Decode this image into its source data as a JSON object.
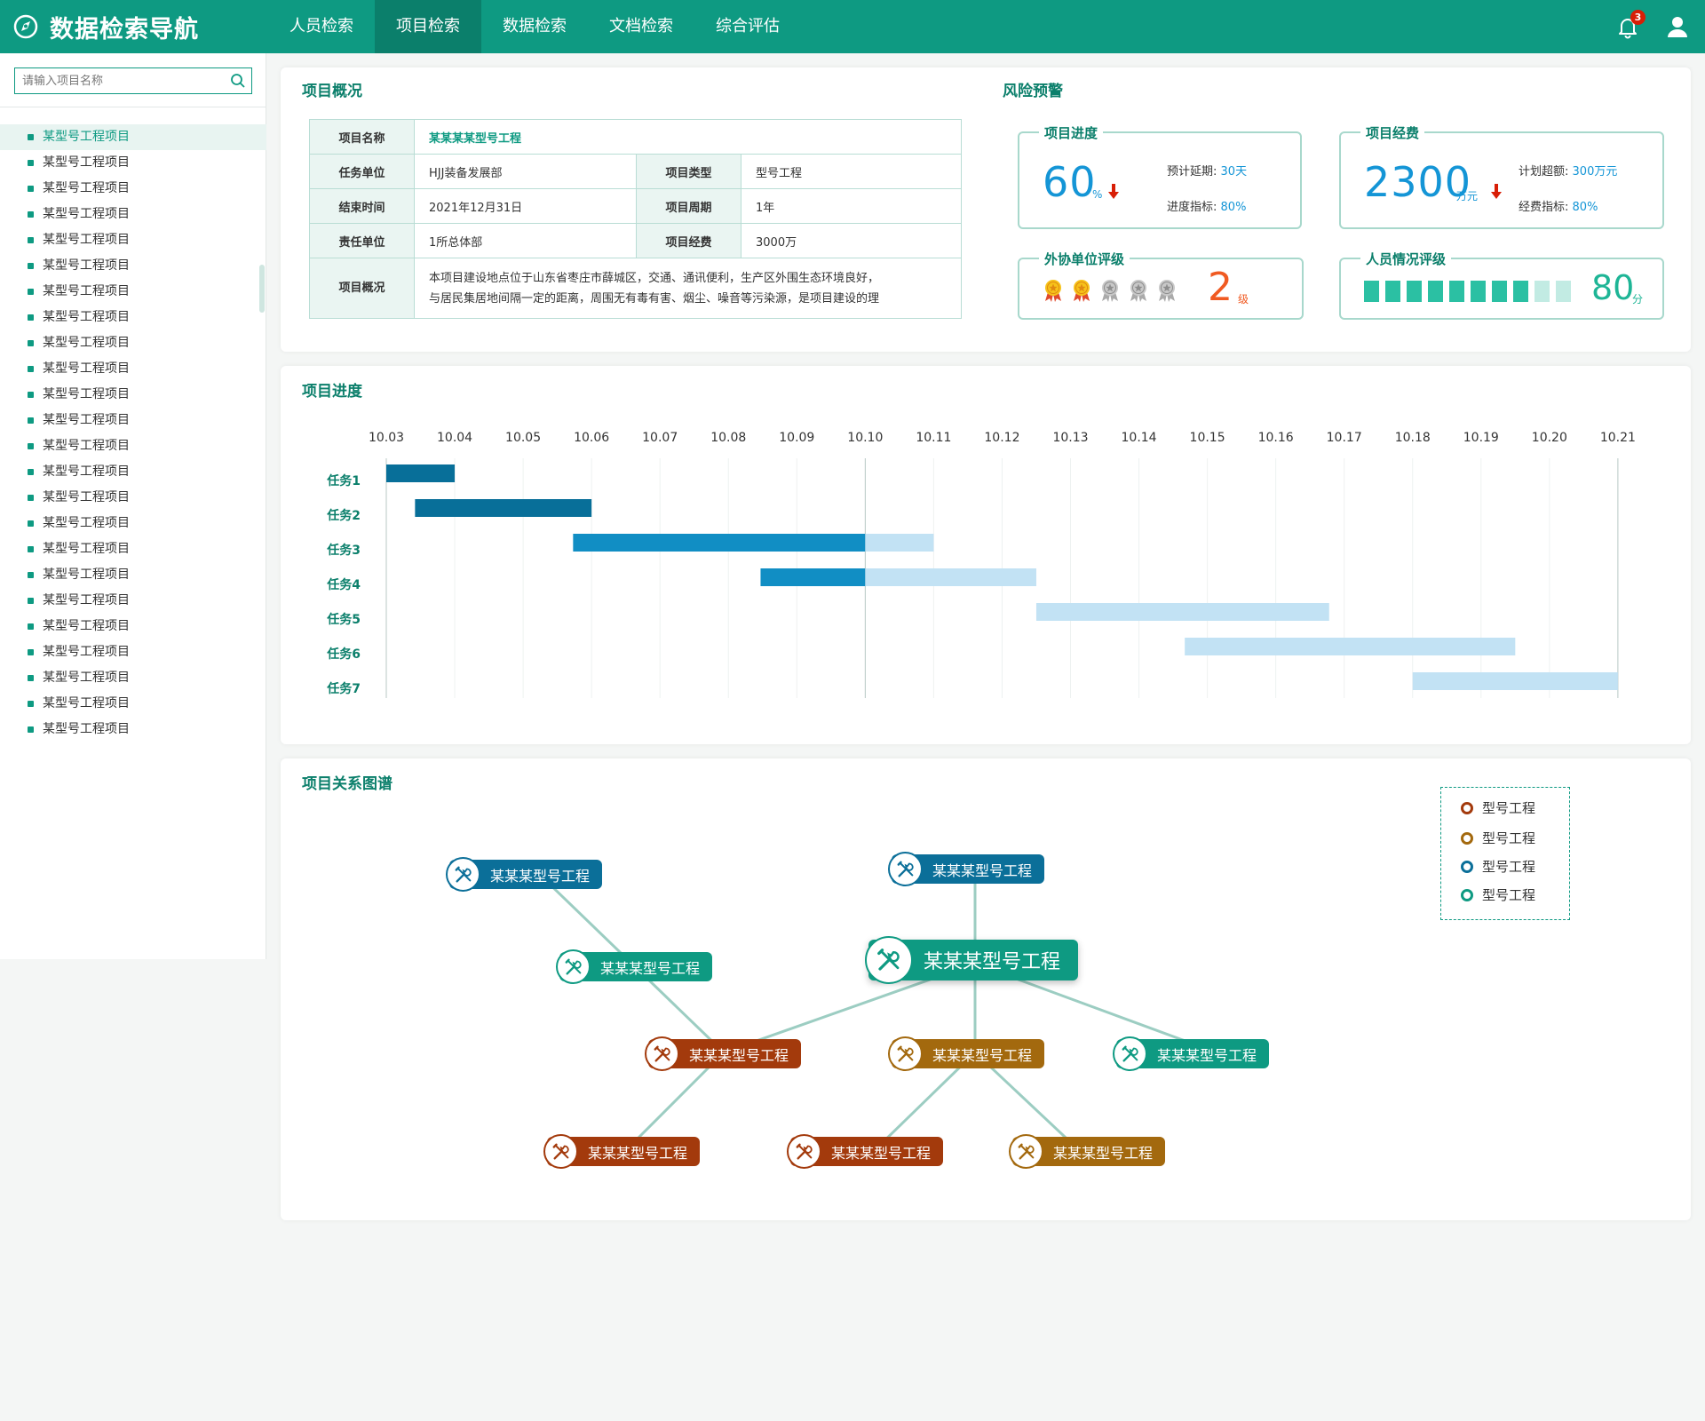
{
  "header": {
    "title": "数据检索导航",
    "nav": [
      "人员检索",
      "项目检索",
      "数据检索",
      "文档检索",
      "综合评估"
    ],
    "active_nav": 1,
    "notification_count": "3"
  },
  "sidebar": {
    "search_placeholder": "请输入项目名称",
    "items": [
      "某型号工程项目",
      "某型号工程项目",
      "某型号工程项目",
      "某型号工程项目",
      "某型号工程项目",
      "某型号工程项目",
      "某型号工程项目",
      "某型号工程项目",
      "某型号工程项目",
      "某型号工程项目",
      "某型号工程项目",
      "某型号工程项目",
      "某型号工程项目",
      "某型号工程项目",
      "某型号工程项目",
      "某型号工程项目",
      "某型号工程项目",
      "某型号工程项目",
      "某型号工程项目",
      "某型号工程项目",
      "某型号工程项目",
      "某型号工程项目",
      "某型号工程项目",
      "某型号工程项目"
    ],
    "selected_index": 0
  },
  "overview": {
    "title": "项目概况",
    "name_label": "项目名称",
    "name_value": "某某某某型号工程",
    "unit_label": "任务单位",
    "unit_value": "HJJ装备发展部",
    "type_label": "项目类型",
    "type_value": "型号工程",
    "end_label": "结束时间",
    "end_value": "2021年12月31日",
    "cycle_label": "项目周期",
    "cycle_value": "1年",
    "resp_label": "责任单位",
    "resp_value": "1所总体部",
    "fund_label": "项目经费",
    "fund_value": "3000万",
    "summary_label": "项目概况",
    "summary_line1": "本项目建设地点位于山东省枣庄市薛城区，交通、通讯便利，生产区外围生态环境良好，",
    "summary_line2": "与居民集居地间隔一定的距离，周围无有毒有害、烟尘、噪音等污染源，是项目建设的理"
  },
  "risk": {
    "title": "风险预警",
    "progress": {
      "title": "项目进度",
      "value": "60",
      "unit": "%",
      "delay_label": "预计延期:",
      "delay_value": "30天",
      "index_label": "进度指标:",
      "index_value": "80%"
    },
    "fund": {
      "title": "项目经费",
      "value": "2300",
      "unit": "万元",
      "over_label": "计划超额:",
      "over_value": "300万元",
      "index_label": "经费指标:",
      "index_value": "80%"
    },
    "partner": {
      "title": "外协单位评级",
      "gold_medals": 2,
      "total_medals": 5,
      "level": "2",
      "level_unit": "级"
    },
    "staff": {
      "title": "人员情况评级",
      "score": "80",
      "score_unit": "分",
      "filled_segments": 8,
      "total_segments": 10
    }
  },
  "gantt": {
    "title": "项目进度",
    "dates": [
      "10.03",
      "10.04",
      "10.05",
      "10.06",
      "10.07",
      "10.08",
      "10.09",
      "10.10",
      "10.11",
      "10.12",
      "10.13",
      "10.14",
      "10.15",
      "10.16",
      "10.17",
      "10.18",
      "10.19",
      "10.20",
      "10.21"
    ],
    "today": "10.10",
    "tasks": [
      {
        "name": "任务1",
        "start": 0,
        "end": 1.0,
        "done_until": 1.0
      },
      {
        "name": "任务2",
        "start": 0.42,
        "end": 3.0,
        "done_until": 3.0
      },
      {
        "name": "任务3",
        "start": 2.73,
        "end": 8.0,
        "done_until": 7.0
      },
      {
        "name": "任务4",
        "start": 5.47,
        "end": 9.5,
        "done_until": 7.0
      },
      {
        "name": "任务5",
        "start": 9.5,
        "end": 13.78,
        "done_until": 9.5
      },
      {
        "name": "任务6",
        "start": 11.67,
        "end": 16.5,
        "done_until": 11.67
      },
      {
        "name": "任务7",
        "start": 15.0,
        "end": 18.0,
        "done_until": 15.0
      }
    ],
    "colors": {
      "done_dark": "#086f99",
      "done": "#118ec4",
      "todo": "#c2e2f4"
    }
  },
  "graph": {
    "title": "项目关系图谱",
    "center": "某某某型号工程",
    "nodes": [
      "某某某型号工程",
      "某某某型号工程",
      "某某某型号工程",
      "某某某型号工程",
      "某某某型号工程",
      "某某某型号工程",
      "某某某型号工程",
      "某某某型号工程",
      "某某某型号工程"
    ],
    "legend": [
      "型号工程",
      "型号工程",
      "型号工程",
      "型号工程"
    ],
    "colors": {
      "red": "#a33a0c",
      "gold": "#a3690e",
      "blue": "#0b6f99",
      "green": "#0e9a82"
    }
  }
}
